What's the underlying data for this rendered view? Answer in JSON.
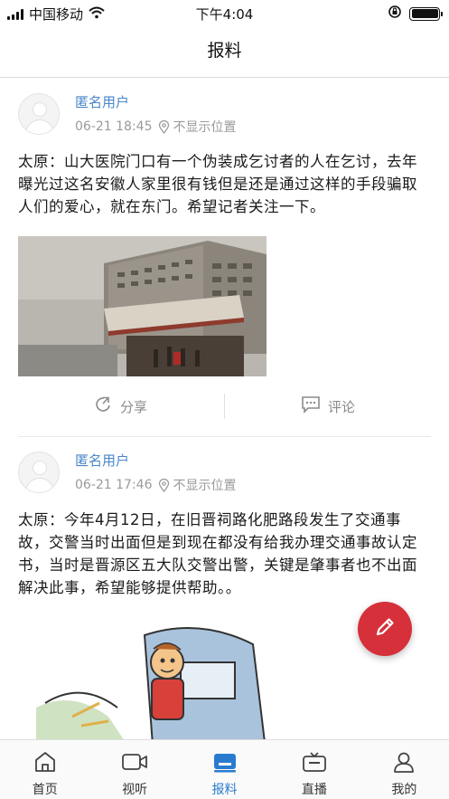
{
  "status_bar": {
    "carrier": "中国移动",
    "time": "下午4:04",
    "battery_level": 1.0
  },
  "nav": {
    "title": "报料"
  },
  "posts": [
    {
      "user": "匿名用户",
      "datetime": "06-21 18:45",
      "location": "不显示位置",
      "text": "太原：山大医院门口有一个伪装成乞讨者的人在乞讨，去年曝光过这名安徽人家里很有钱但是还是通过这样的手段骗取人们的爱心，就在东门。希望记者关注一下。",
      "has_photo": true
    },
    {
      "user": "匿名用户",
      "datetime": "06-21 17:46",
      "location": "不显示位置",
      "text": "太原：今年4月12日，在旧晋祠路化肥路段发生了交通事故，交警当时出面但是到现在都没有给我办理交通事故认定书，当时是晋源区五大队交警出警，关键是肇事者也不出面解决此事，希望能够提供帮助。。",
      "has_photo": true
    }
  ],
  "actions": {
    "share_label": "分享",
    "comment_label": "评论"
  },
  "fab": {
    "icon": "pencil-icon"
  },
  "tabs": [
    {
      "label": "首页",
      "icon": "home-icon",
      "active": false
    },
    {
      "label": "视听",
      "icon": "video-icon",
      "active": false
    },
    {
      "label": "报料",
      "icon": "tipoff-icon",
      "active": true
    },
    {
      "label": "直播",
      "icon": "tv-icon",
      "active": false
    },
    {
      "label": "我的",
      "icon": "user-icon",
      "active": false
    }
  ],
  "colors": {
    "accent_blue": "#2a7bd0",
    "username_blue": "#4a86c8",
    "fab_red": "#d6303a"
  }
}
